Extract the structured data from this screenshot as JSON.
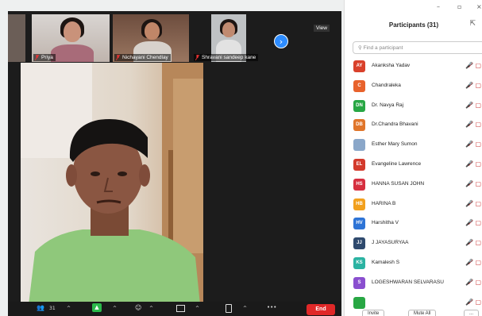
{
  "window": {
    "minimize": "–",
    "maximize": "▫",
    "close": "×"
  },
  "thumbnails": [
    {
      "name": "Priya"
    },
    {
      "name": "Nichayani Chendlay"
    },
    {
      "name": "Shravani sandeep kane"
    }
  ],
  "view_label": "View",
  "next_glyph": "›",
  "toolbar": {
    "participants_glyph": "👥",
    "participants_count": "31",
    "share_glyph": "▲",
    "reactions_glyph": "☺",
    "caret": "^",
    "more_glyph": "•••",
    "end_label": "End"
  },
  "panel": {
    "title": "Participants (31)",
    "popout_glyph": "⇱",
    "search_placeholder": "Find a participant",
    "participants": [
      {
        "initials": "AY",
        "name": "Akanksha Yadav",
        "color": "#d9412b"
      },
      {
        "initials": "C",
        "name": "Chandraleka",
        "color": "#e8622c"
      },
      {
        "initials": "DN",
        "name": "Dr. Navya Raj",
        "color": "#28a744"
      },
      {
        "initials": "DB",
        "name": "Dr.Chandra Bhavani",
        "color": "#e0752a"
      },
      {
        "initials": "",
        "name": "Esther Mary Sumon",
        "color": "#8aa7c9"
      },
      {
        "initials": "EL",
        "name": "Evangeline Lawrence",
        "color": "#d33a2c"
      },
      {
        "initials": "HS",
        "name": "HANNA SUSAN JOHN",
        "color": "#d62f3f"
      },
      {
        "initials": "HB",
        "name": "HARINA B",
        "color": "#f2a01d"
      },
      {
        "initials": "HV",
        "name": "Harshitha V",
        "color": "#2e74d6"
      },
      {
        "initials": "JJ",
        "name": "J JAYASURYAA",
        "color": "#2f4a6e"
      },
      {
        "initials": "KS",
        "name": "Kamalesh S",
        "color": "#2bb3a2"
      },
      {
        "initials": "S",
        "name": "LOGESHWARAN SELVARASU",
        "color": "#8a4fcf"
      },
      {
        "initials": "",
        "name": "",
        "color": "#28a744"
      }
    ],
    "row_icons": "🎤̸ ▢",
    "buttons": {
      "invite": "Invite",
      "mute_all": "Mute All",
      "more": "..."
    }
  }
}
